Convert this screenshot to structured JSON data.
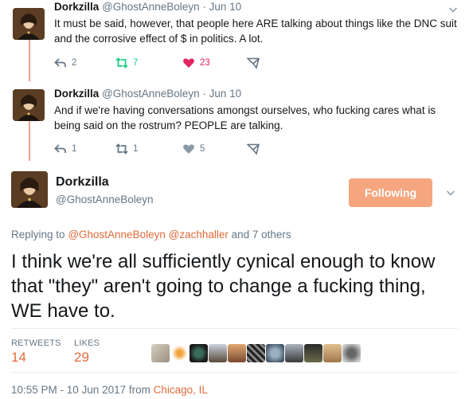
{
  "tweets": [
    {
      "name": "Dorkzilla",
      "handle": "@GhostAnneBoleyn",
      "date": "· Jun 10",
      "text": "It must be said, however, that people here ARE talking about things like the DNC suit and the corrosive effect of $ in politics. A lot.",
      "replies": "2",
      "retweets": "7",
      "likes": "23"
    },
    {
      "name": "Dorkzilla",
      "handle": "@GhostAnneBoleyn",
      "date": "· Jun 10",
      "text": "And if we're having conversations amongst ourselves, who fucking cares what is being said on the rostrum? PEOPLE are talking.",
      "replies": "1",
      "retweets": "1",
      "likes": "5"
    }
  ],
  "main": {
    "name": "Dorkzilla",
    "handle": "@GhostAnneBoleyn",
    "follow_label": "Following",
    "replying_prefix": "Replying to",
    "replying_mention1": "@GhostAnneBoleyn",
    "replying_mention2": "@zachhaller",
    "replying_suffix": "and 7 others",
    "text": "I think we're all sufficiently cynical enough to know that \"they\" aren't going to change a fucking thing, WE have to.",
    "retweets_label": "RETWEETS",
    "retweets_count": "14",
    "likes_label": "LIKES",
    "likes_count": "29",
    "timestamp": "10:55 PM - 10 Jun 2017 from",
    "location": "Chicago, IL"
  },
  "colors": {
    "accent": "#e06b3a",
    "follow_button": "#f5a67f",
    "retweet_active": "#19cf86",
    "like_active": "#e0245e",
    "muted": "#657786",
    "thread_line": "#f0a48a"
  },
  "icons": [
    "reply-icon",
    "retweet-icon",
    "heart-icon",
    "direct-message-icon",
    "chevron-down-icon"
  ]
}
